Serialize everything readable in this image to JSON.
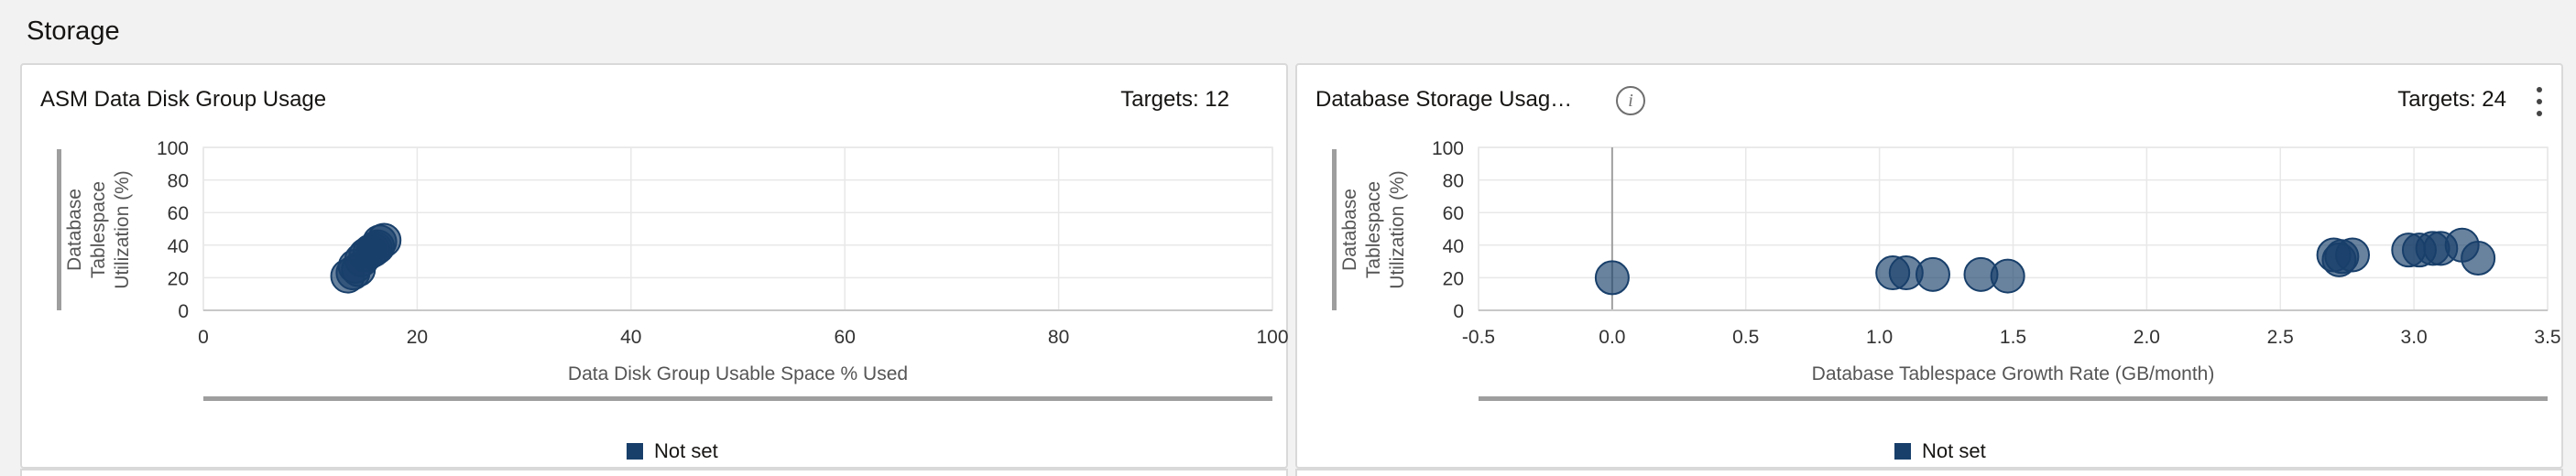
{
  "section": {
    "title": "Storage"
  },
  "colors": {
    "marker": "#183f6a",
    "grid": "#e8e8e8",
    "axis": "#9e9e9e"
  },
  "cards": [
    {
      "title": "ASM Data Disk Group Usage",
      "targets": "Targets: 12",
      "legend_label": "Not set",
      "has_info": false,
      "has_menu": false,
      "has_zoom": false
    },
    {
      "title": "Database Storage Usag…",
      "targets": "Targets: 24",
      "legend_label": "Not set",
      "has_info": true,
      "info_icon": "info-icon",
      "has_menu": true,
      "menu_icon": "kebab-menu-icon",
      "has_zoom": true,
      "zoom_icon": "magnifier-icon"
    }
  ],
  "chart_data": [
    {
      "type": "scatter",
      "title": "ASM Data Disk Group Usage",
      "xlabel": "Data Disk Group Usable Space % Used",
      "ylabel": [
        "Database",
        "Tablespace",
        "Utilization (%)"
      ],
      "xlim": [
        0,
        100
      ],
      "ylim": [
        0,
        100
      ],
      "xticks": [
        0,
        20,
        40,
        60,
        80,
        100
      ],
      "xtick_labels": [
        "0",
        "20",
        "40",
        "60",
        "80",
        "100"
      ],
      "yticks": [
        0,
        20,
        40,
        60,
        80,
        100
      ],
      "ytick_labels": [
        "0",
        "20",
        "40",
        "60",
        "80",
        "100"
      ],
      "grid": true,
      "legend_placement": "bottom",
      "series": [
        {
          "name": "Not set",
          "x": [
            13.5,
            14.0,
            14.2,
            14.8,
            15.2,
            15.6,
            16.1,
            16.5,
            16.9,
            15.9,
            14.5,
            16.3
          ],
          "y": [
            21,
            23,
            27,
            31,
            34,
            36,
            38,
            42,
            43,
            37,
            25,
            39
          ]
        }
      ]
    },
    {
      "type": "scatter",
      "title": "Database Storage Usag…",
      "xlabel": "Database Tablespace Growth Rate (GB/month)",
      "ylabel": [
        "Database",
        "Tablespace",
        "Utilization (%)"
      ],
      "xlim": [
        -0.5,
        3.5
      ],
      "ylim": [
        0,
        100
      ],
      "xticks": [
        -0.5,
        0.0,
        0.5,
        1.0,
        1.5,
        2.0,
        2.5,
        3.0,
        3.5
      ],
      "xtick_labels": [
        "-0.5",
        "0.0",
        "0.5",
        "1.0",
        "1.5",
        "2.0",
        "2.5",
        "3.0",
        "3.5"
      ],
      "yticks": [
        0,
        20,
        40,
        60,
        80,
        100
      ],
      "ytick_labels": [
        "0",
        "20",
        "40",
        "60",
        "80",
        "100"
      ],
      "grid": true,
      "zero_line_x": 0,
      "legend_placement": "bottom",
      "series": [
        {
          "name": "Not set",
          "x": [
            0.0,
            1.05,
            1.1,
            1.2,
            1.38,
            1.48,
            2.7,
            2.73,
            2.77,
            2.98,
            3.02,
            3.07,
            3.1,
            3.18,
            3.24,
            2.72
          ],
          "y": [
            20,
            23,
            23,
            22,
            22,
            21,
            34,
            33,
            34,
            37,
            37,
            38,
            38,
            40,
            32,
            31
          ]
        }
      ]
    }
  ]
}
